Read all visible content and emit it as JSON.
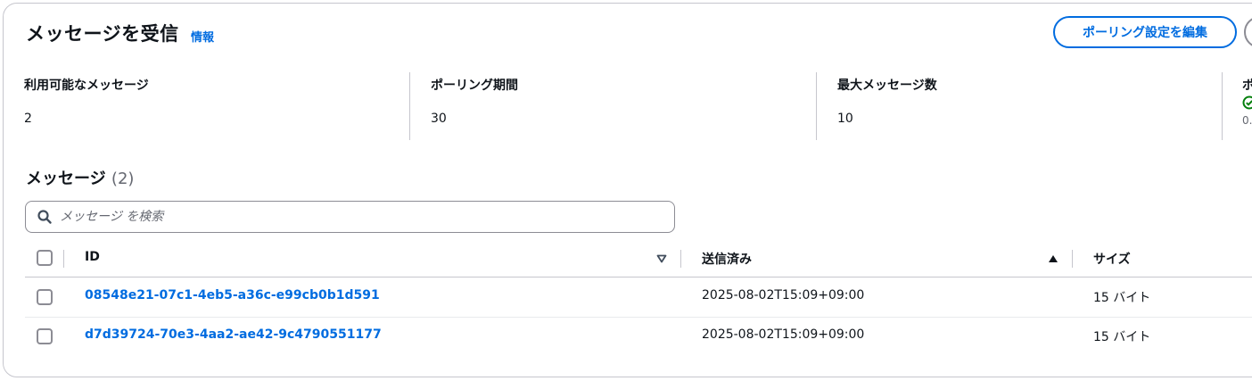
{
  "header": {
    "title": "メッセージを受信",
    "info_link": "情報",
    "edit_button": "ポーリング設定を編集"
  },
  "stats": [
    {
      "label": "利用可能なメッセージ",
      "value": "2"
    },
    {
      "label": "ポーリング期間",
      "value": "30"
    },
    {
      "label": "最大メッセージ数",
      "value": "10"
    },
    {
      "label": "ポ",
      "value": "0."
    }
  ],
  "messages": {
    "title": "メッセージ",
    "count": "(2)",
    "search_placeholder": "メッセージ を検索",
    "columns": {
      "id": "ID",
      "sent": "送信済み",
      "size": "サイズ"
    },
    "rows": [
      {
        "id": "08548e21-07c1-4eb5-a36c-e99cb0b1d591",
        "sent": "2025-08-02T15:09+09:00",
        "size": "15 バイト"
      },
      {
        "id": "d7d39724-70e3-4aa2-ae42-9c4790551177",
        "sent": "2025-08-02T15:09+09:00",
        "size": "15 バイト"
      }
    ]
  },
  "colors": {
    "link": "#006ce0",
    "border": "#c6c6cd",
    "success": "#037f0c"
  },
  "icons": {
    "search": "search-icon",
    "status": "check-circle-icon",
    "sort_id": "caret-down-icon",
    "sort_sent": "caret-up-icon"
  }
}
